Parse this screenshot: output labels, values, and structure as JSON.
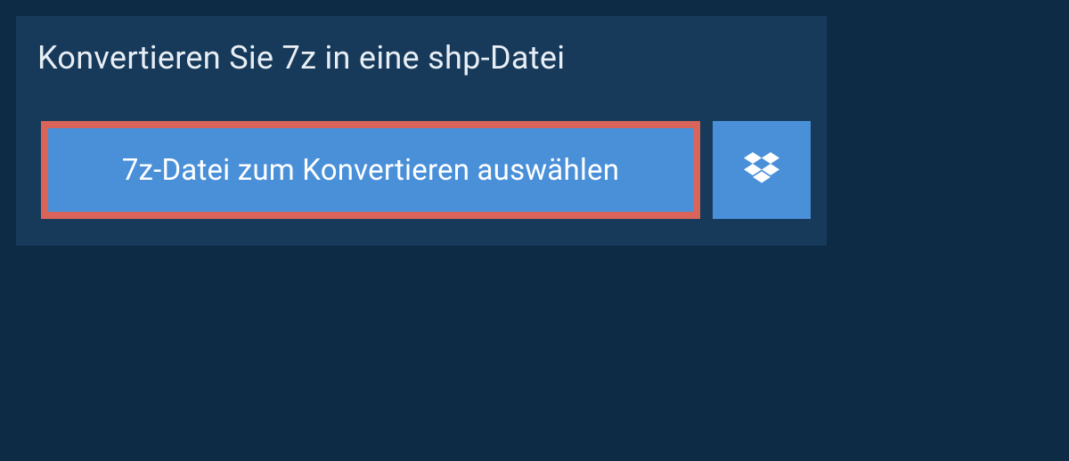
{
  "heading": "Konvertieren Sie 7z in eine shp-Datei",
  "buttons": {
    "select_label": "7z-Datei zum Konvertieren auswählen"
  },
  "colors": {
    "background": "#0d2b45",
    "panel": "#173a5a",
    "button": "#4a90d9",
    "highlight_border": "#d96459"
  },
  "icons": {
    "dropbox": "dropbox-icon"
  }
}
